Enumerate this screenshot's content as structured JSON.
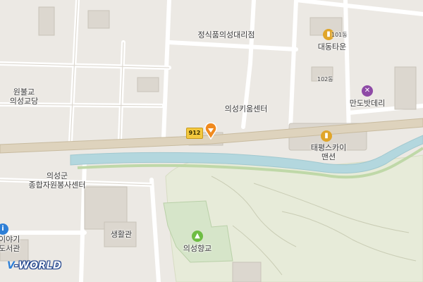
{
  "map": {
    "road_number": "912",
    "labels": {
      "restaurant": "정식품의성대리점",
      "daedong_town": "대동타운",
      "bldg_101": "101동",
      "bldg_102": "102동",
      "mando_bar": "만도밧데리",
      "wonbul_line1": "원불교",
      "wonbul_line2": "의성교당",
      "kium_center": "의성키움센터",
      "taepyeong_line1": "태평스카이",
      "taepyeong_line2": "맨션",
      "volunteer_line1": "의성군",
      "volunteer_line2": "종합자원봉사센터",
      "saenghwal": "생활관",
      "hyanggyo": "의성향교",
      "library_line1": "이야기",
      "library_line2": "도서관"
    },
    "logo": {
      "v": "V",
      "rest": "-WORLD"
    },
    "colors": {
      "background": "#ece9e4",
      "main_road": "#ded3bd",
      "river": "#b3d7de",
      "park": "#d6e5c9",
      "hill": "#e7ebd9",
      "pin": "#f08a1f"
    },
    "icons": {
      "apartment": "building-icon",
      "repair": "tools-icon",
      "landmark": "monument-icon",
      "library": "info-icon",
      "location": "location-pin-icon"
    }
  }
}
